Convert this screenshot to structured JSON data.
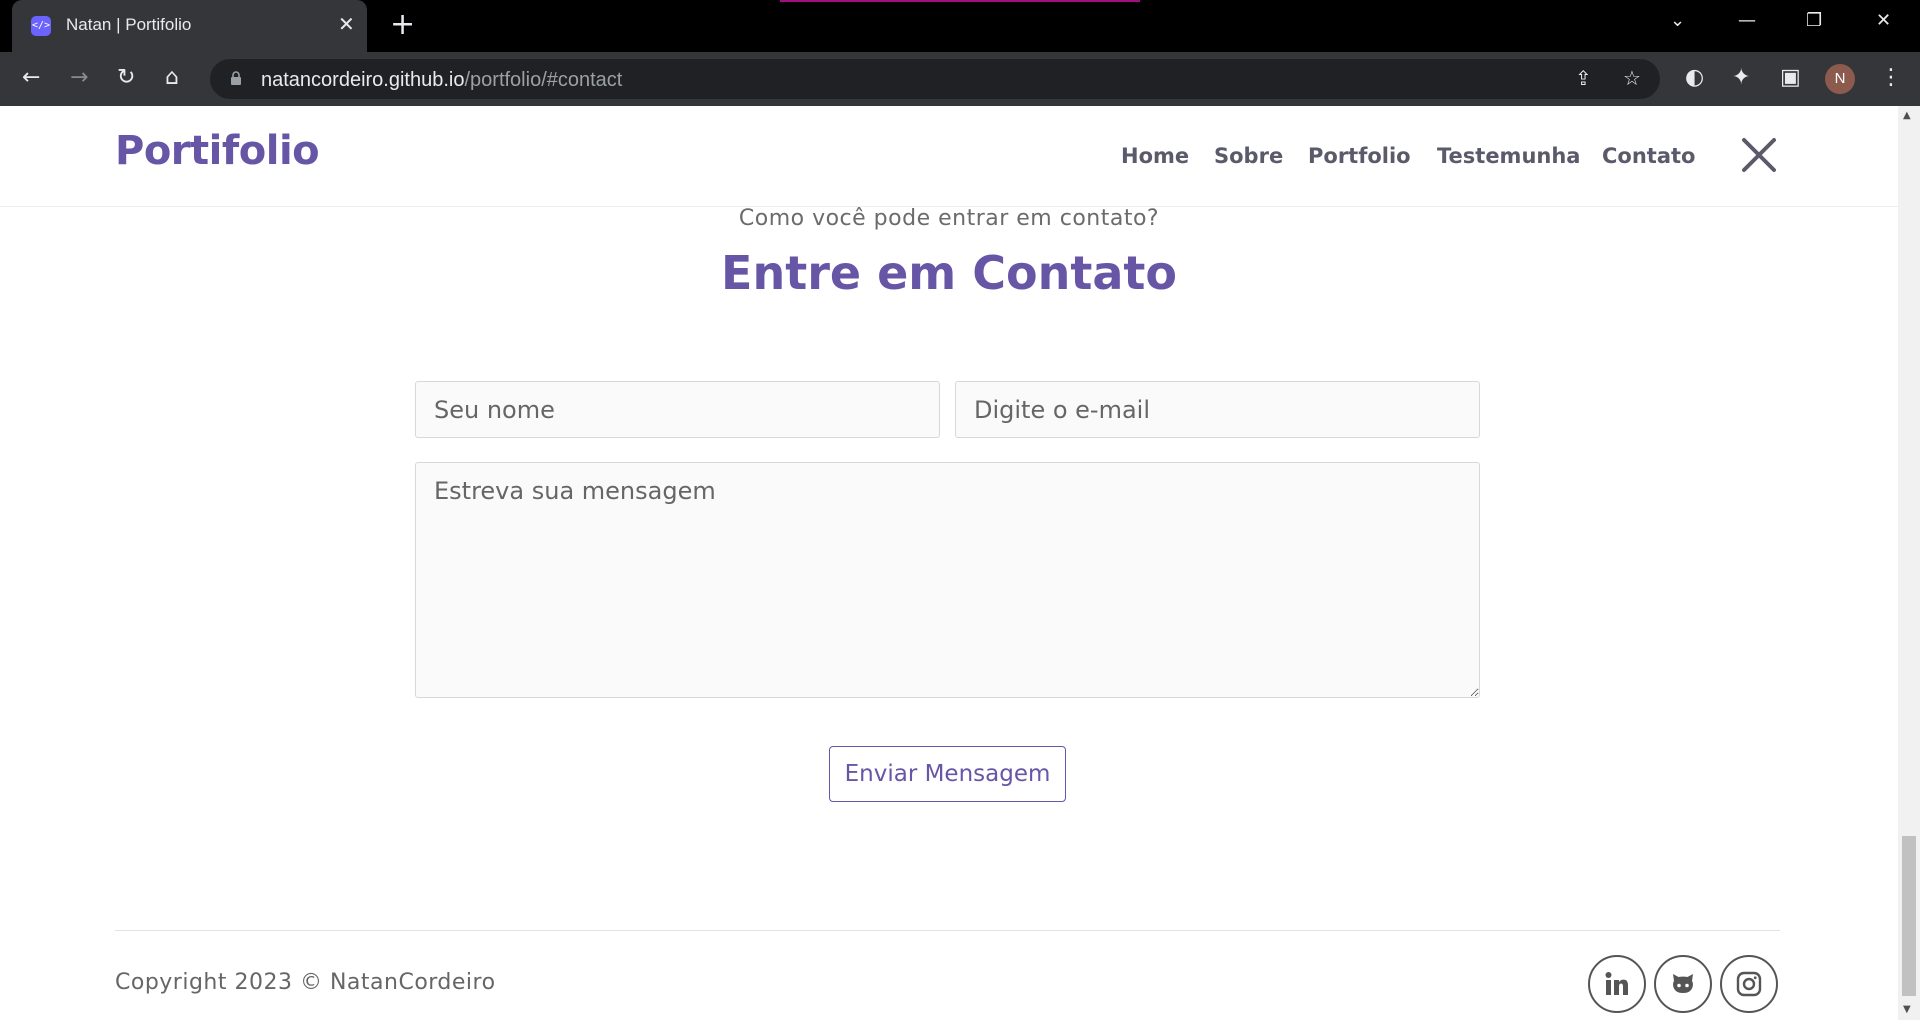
{
  "browser": {
    "tab_title": "Natan | Portifolio",
    "tab_favicon": "</>",
    "url_host": "natancordeiro.github.io",
    "url_path": "/portfolio/#contact",
    "profile_initial": "N"
  },
  "header": {
    "logo": "Portifolio",
    "nav": [
      "Home",
      "Sobre",
      "Portfolio",
      "Testemunha",
      "Contato"
    ]
  },
  "contact": {
    "subtitle": "Como você pode entrar em contato?",
    "title": "Entre em Contato",
    "name_placeholder": "Seu nome",
    "email_placeholder": "Digite o e-mail",
    "message_placeholder": "Estreva sua mensagem",
    "send_label": "Enviar Mensagem"
  },
  "footer": {
    "copyright": "Copyright 2023 © NatanCordeiro",
    "social_icons": [
      "linkedin-icon",
      "github-icon",
      "instagram-icon"
    ]
  },
  "colors": {
    "accent": "#6755a6",
    "chrome_dark": "#35363a",
    "nav_text": "#5a5a6b"
  }
}
